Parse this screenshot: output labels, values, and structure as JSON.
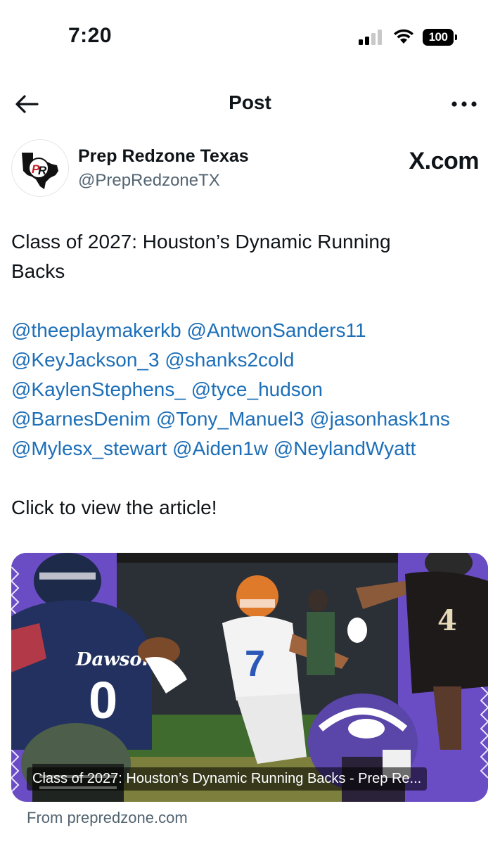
{
  "status_bar": {
    "time": "7:20",
    "battery": "100"
  },
  "nav": {
    "title": "Post",
    "back_icon": "arrow-left-icon",
    "more_icon": "ellipsis-icon"
  },
  "author": {
    "display_name": "Prep Redzone Texas",
    "handle": "@PrepRedzoneTX",
    "avatar_icon": "texas-pr-logo",
    "watermark": "X.com"
  },
  "post": {
    "title_lines": [
      "Class of 2027: Houston’s Dynamic Running",
      "Backs"
    ],
    "mention_lines": [
      [
        "@theeplaymakerkb",
        "@AntwonSanders11"
      ],
      [
        "@KeyJackson_3",
        "@shanks2cold"
      ],
      [
        "@KaylenStephens_",
        "@tyce_hudson"
      ],
      [
        "@BarnesDenim",
        "@Tony_Manuel3",
        "@jasonhask1ns"
      ],
      [
        "@Mylesx_stewart",
        "@Aiden1w",
        "@NeylandWyatt"
      ]
    ],
    "cta": "Click to view the article!"
  },
  "card": {
    "caption": "Class of 2027: Houston’s Dynamic Running Backs - Prep Re...",
    "from": "From prepredzone.com",
    "colors": {
      "accent": "#6a4cc4",
      "mention": "#1d6fb8"
    }
  }
}
